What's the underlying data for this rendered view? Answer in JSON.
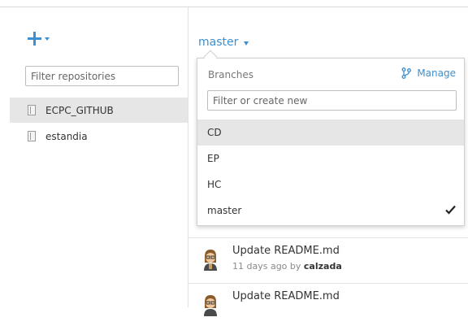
{
  "sidebar": {
    "filter_placeholder": "Filter repositories",
    "repositories": [
      {
        "name": "ECPC_GITHUB",
        "selected": true
      },
      {
        "name": "estandia",
        "selected": false
      }
    ]
  },
  "branch_selector": {
    "current": "master"
  },
  "dropdown": {
    "header": "Branches",
    "manage_label": "Manage",
    "filter_placeholder": "Filter or create new",
    "branches": [
      {
        "name": "CD",
        "highlighted": true,
        "checked": false
      },
      {
        "name": "EP",
        "highlighted": false,
        "checked": false
      },
      {
        "name": "HC",
        "highlighted": false,
        "checked": false
      },
      {
        "name": "master",
        "highlighted": false,
        "checked": true
      }
    ]
  },
  "commits": [
    {
      "title": "Update README.md",
      "age": "11 days ago by",
      "author": "calzada"
    },
    {
      "title": "Update README.md",
      "age": "",
      "author": ""
    }
  ],
  "colors": {
    "accent": "#3c8fd0",
    "selected_bg": "#e6e6e6"
  },
  "icons": {
    "add": "plus-icon",
    "repo": "repo-book-icon",
    "branch": "branch-icon",
    "check": "checkmark-icon"
  }
}
